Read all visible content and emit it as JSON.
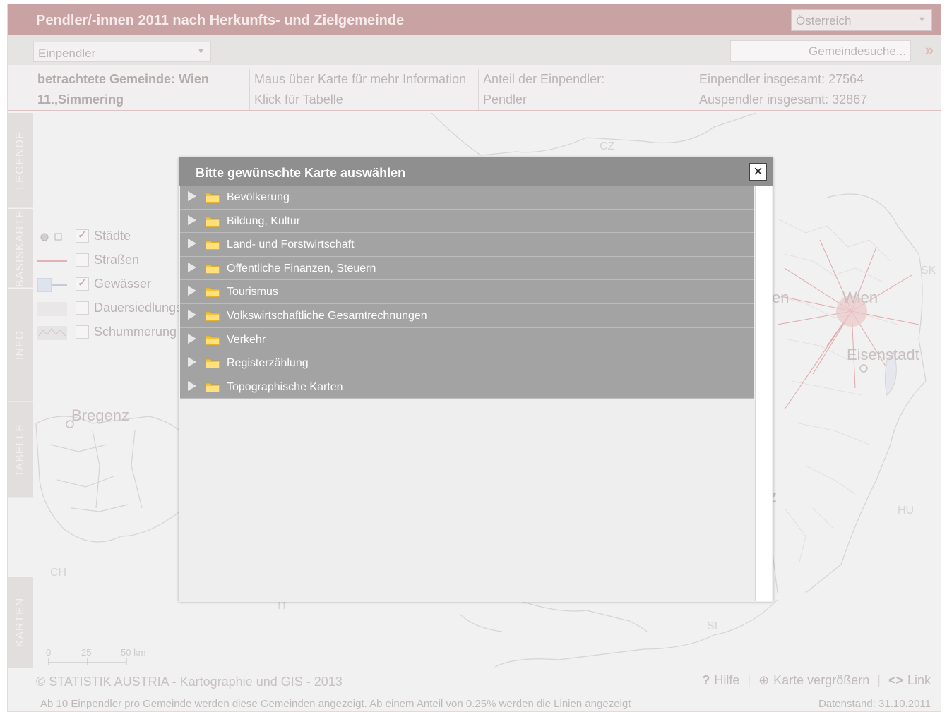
{
  "app": {
    "title": "Pendler/-innen 2011 nach Herkunfts- und Zielgemeinde",
    "country_select": "Österreich"
  },
  "toolbar": {
    "mode_select": "Einpendler",
    "search_placeholder": "Gemeindesuche...",
    "search_go": "»"
  },
  "info": {
    "selected_label_line1": "betrachtete Gemeinde: Wien",
    "selected_label_line2": "11.,Simmering",
    "hint_line1": "Maus über Karte für mehr Information",
    "hint_line2": "Klick für Tabelle",
    "share_line1": "Anteil der Einpendler:",
    "share_line2": "Pendler",
    "total_in": "Einpendler insgesamt: 27564",
    "total_out": "Auspendler insgesamt: 32867"
  },
  "side_tabs": [
    {
      "label": "LEGENDE"
    },
    {
      "label": "BASISKARTE"
    },
    {
      "label": "INFO"
    },
    {
      "label": "TABELLE"
    },
    {
      "label": "KARTEN"
    }
  ],
  "legend": {
    "items": [
      {
        "label": "Städte",
        "checked": true,
        "mark": "✓"
      },
      {
        "label": "Straßen",
        "checked": false,
        "mark": ""
      },
      {
        "label": "Gewässer",
        "checked": true,
        "mark": "✓"
      },
      {
        "label": "Dauersiedlungsraum",
        "checked": false,
        "mark": ""
      },
      {
        "label": "Schummerung",
        "checked": false,
        "mark": ""
      }
    ]
  },
  "map": {
    "labels": {
      "cz": "CZ",
      "sk": "SK",
      "hu": "HU",
      "ch": "CH",
      "si": "SI",
      "it": "IT",
      "wien": "Wien",
      "wien_partial": "en",
      "eisenstadt": "Eisenstadt",
      "bregenz": "Bregenz",
      "z_partial": "z"
    },
    "scale": {
      "zero": "0",
      "mid": "25",
      "end": "50 km"
    }
  },
  "footer": {
    "copyright": "© STATISTIK AUSTRIA - Kartographie und GIS - 2013",
    "help": "Hilfe",
    "enlarge": "Karte vergrößern",
    "link": "Link",
    "note": "Ab 10 Einpendler pro Gemeinde werden diese Gemeinden angezeigt. Ab einem Anteil von 0.25% werden die Linien angezeigt",
    "date": "Datenstand: 31.10.2011"
  },
  "modal": {
    "title": "Bitte gewünschte Karte auswählen",
    "close": "×",
    "categories": [
      {
        "label": "Bevölkerung"
      },
      {
        "label": "Bildung, Kultur"
      },
      {
        "label": "Land- und Forstwirtschaft"
      },
      {
        "label": "Öffentliche Finanzen, Steuern"
      },
      {
        "label": "Tourismus"
      },
      {
        "label": "Volkswirtschaftliche Gesamtrechnungen"
      },
      {
        "label": "Verkehr"
      },
      {
        "label": "Registerzählung"
      },
      {
        "label": "Topographische Karten"
      }
    ]
  }
}
